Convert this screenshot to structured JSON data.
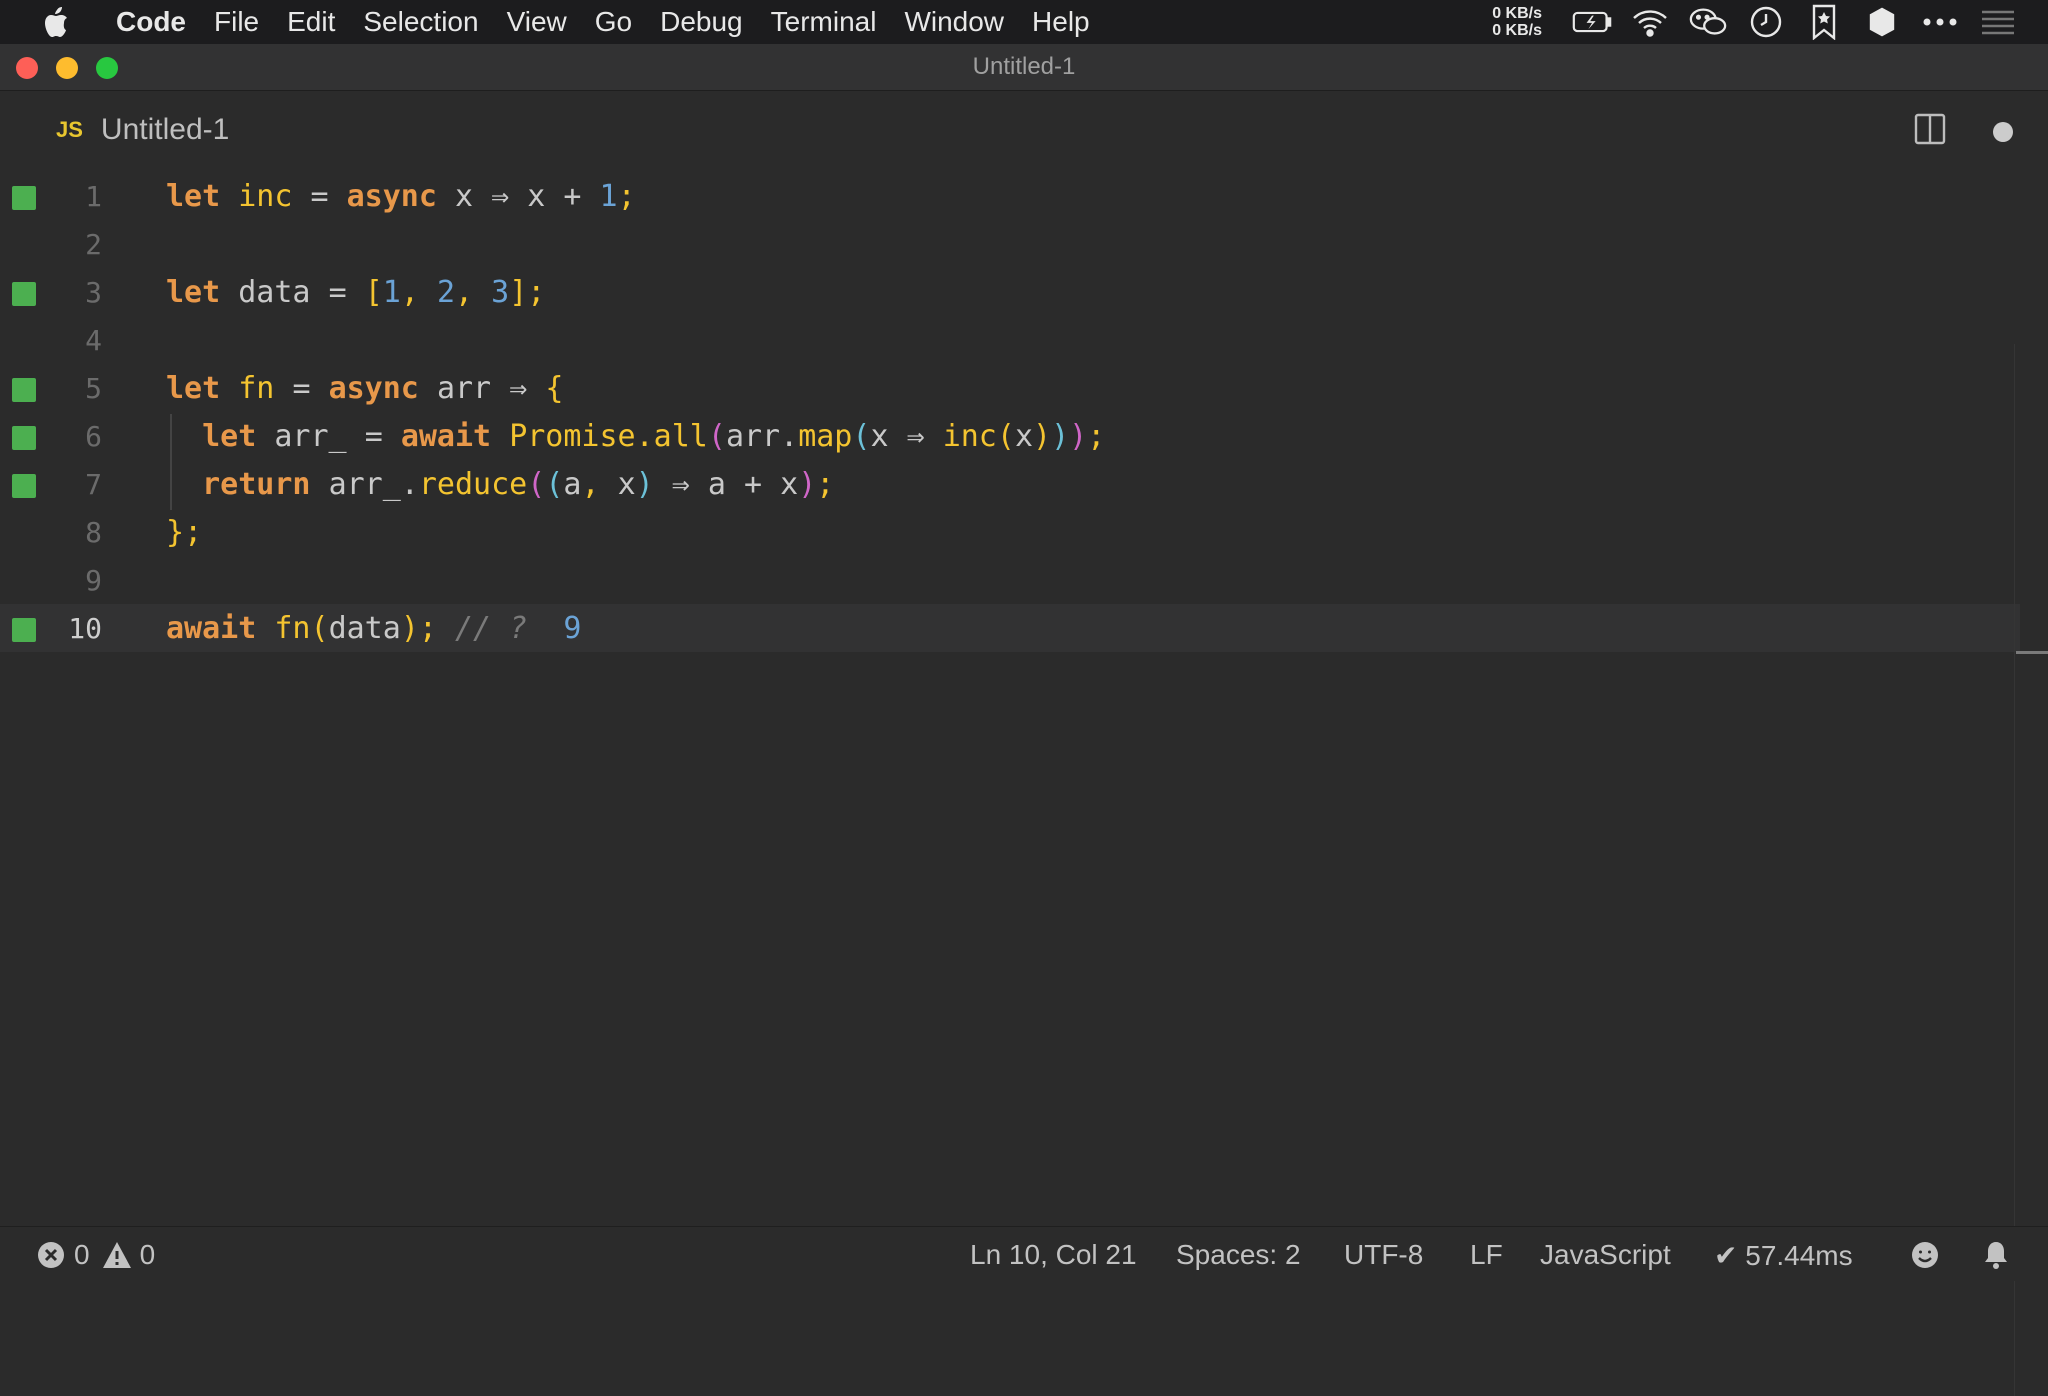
{
  "menubar": {
    "app_name": "Code",
    "items": [
      "File",
      "Edit",
      "Selection",
      "View",
      "Go",
      "Debug",
      "Terminal",
      "Window",
      "Help"
    ],
    "net_up": "0 KB/s",
    "net_down": "0 KB/s",
    "icons": [
      "battery-icon",
      "wifi-icon",
      "wechat-icon",
      "clock-icon",
      "bookmark-icon",
      "dropzone-icon",
      "more-icon",
      "list-icon"
    ]
  },
  "window": {
    "title": "Untitled-1",
    "traffic_colors": [
      "#fe5f57",
      "#febc2e",
      "#28c840"
    ]
  },
  "tab": {
    "lang_badge": "JS",
    "label": "Untitled-1"
  },
  "editor": {
    "lines": [
      {
        "number": "1",
        "covered": true
      },
      {
        "number": "2",
        "covered": false
      },
      {
        "number": "3",
        "covered": true
      },
      {
        "number": "4",
        "covered": false
      },
      {
        "number": "5",
        "covered": true
      },
      {
        "number": "6",
        "covered": true
      },
      {
        "number": "7",
        "covered": true
      },
      {
        "number": "8",
        "covered": false
      },
      {
        "number": "9",
        "covered": false
      },
      {
        "number": "10",
        "covered": true
      }
    ],
    "code": {
      "l1": [
        "let",
        "inc",
        "=",
        "async",
        "x",
        "⇒",
        "x",
        "+",
        "1",
        ";"
      ],
      "l3": [
        "let",
        "data",
        "=",
        "[",
        "1",
        ",",
        "2",
        ",",
        "3",
        "]",
        ";"
      ],
      "l5": [
        "let",
        "fn",
        "=",
        "async",
        "arr",
        "⇒",
        "{"
      ],
      "l6": [
        "let",
        "arr_",
        "=",
        "await",
        "Promise",
        ".all",
        "(",
        "arr.",
        "map",
        "(",
        "x",
        "⇒",
        "inc",
        "(",
        "x",
        ")",
        ")",
        ")",
        ";"
      ],
      "l7": [
        "return",
        "arr_.",
        "reduce",
        "(",
        "(",
        "a",
        ",",
        "x",
        ")",
        "⇒",
        "a",
        "+",
        "x",
        ")",
        ";"
      ],
      "l8": [
        "}",
        ";"
      ],
      "l10": [
        "await",
        "fn",
        "(",
        "data",
        ")",
        ";",
        "// ?",
        "9"
      ]
    },
    "coverage_color": "#4caf50"
  },
  "statusbar": {
    "errors": "0",
    "warnings": "0",
    "position": "Ln 10, Col 21",
    "spaces": "Spaces: 2",
    "encoding": "UTF-8",
    "eol": "LF",
    "language": "JavaScript",
    "timing": "✔ 57.44ms"
  }
}
